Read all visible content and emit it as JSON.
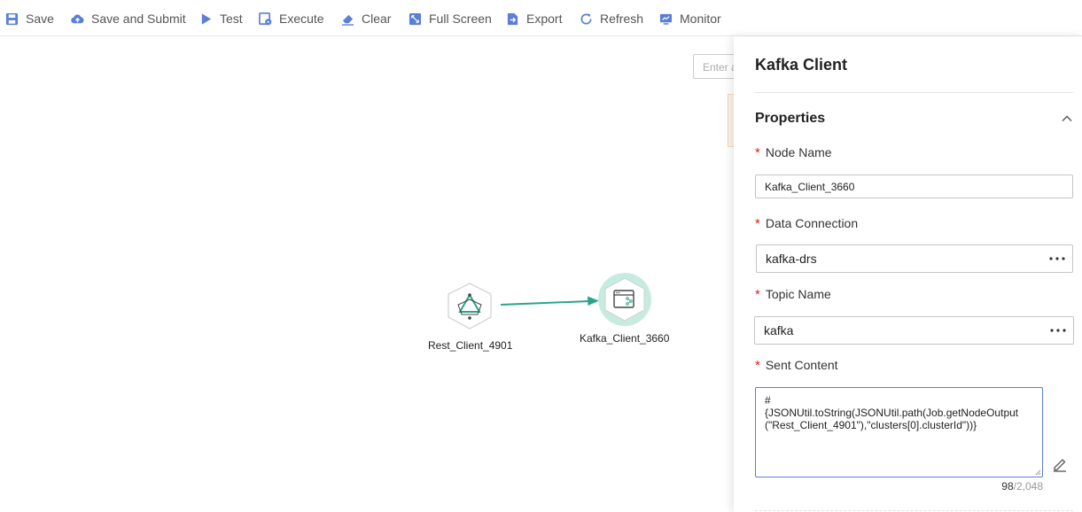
{
  "toolbar": {
    "save": "Save",
    "save_submit": "Save and Submit",
    "test": "Test",
    "execute": "Execute",
    "clear": "Clear",
    "full_screen": "Full Screen",
    "export": "Export",
    "refresh": "Refresh",
    "monitor": "Monitor",
    "icon_color": "#5b7fd6"
  },
  "canvas": {
    "search_placeholder": "Enter a",
    "nodes": [
      {
        "label": "Rest_Client_4901",
        "icon": "rest-client-icon"
      },
      {
        "label": "Kafka_Client_3660",
        "icon": "kafka-client-icon",
        "selected": true
      }
    ],
    "edge_color": "#2aa58c"
  },
  "panel": {
    "title": "Kafka Client",
    "section": "Properties",
    "required_mark": "*",
    "node_name": {
      "label": "Node Name",
      "value": "Kafka_Client_3660"
    },
    "data_connection": {
      "label": "Data Connection",
      "value": "kafka-drs"
    },
    "topic_name": {
      "label": "Topic Name",
      "value": "kafka"
    },
    "sent_content": {
      "label": "Sent Content",
      "value": "#\n{JSONUtil.toString(JSONUtil.path(Job.getNodeOutput(\"Rest_Client_4901\"),\"clusters[0].clusterId\"))}",
      "count": "98",
      "max": "/2,048"
    }
  }
}
